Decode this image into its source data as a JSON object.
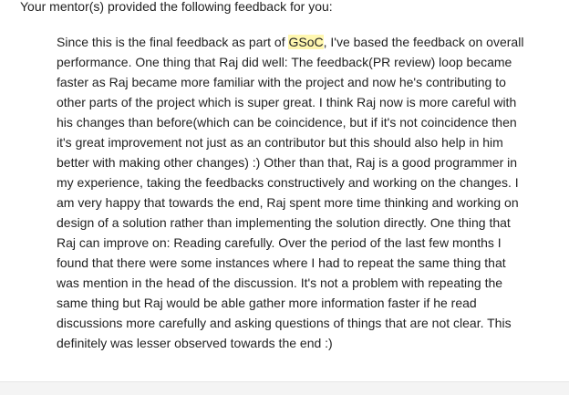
{
  "intro": "Your mentor(s) provided the following feedback for you:",
  "feedback": {
    "line1_before": "Since this is the final feedback as part of ",
    "highlight": "GSoC",
    "line1_after": ", I've based the feedback on overall",
    "lines": [
      "performance. One thing that Raj did well: The feedback(PR review) loop became",
      "faster as Raj became more familiar with the project and now he's contributing to",
      "other parts of the project which is super great. I think Raj now is more careful with",
      "his changes than before(which can be coincidence, but if it's not coincidence then",
      "it's great improvement not just as an contributor but this should also help in him",
      "better with making other changes) :) Other than that, Raj is a good programmer in",
      "my experience, taking the feedbacks constructively and working on the changes. I",
      "am very happy that towards the end, Raj spent more time thinking and working on",
      "design of a solution rather than implementing the solution directly. One thing that",
      "Raj can improve on: Reading carefully. Over the period of the last few months I",
      "found that there were some instances where I had to repeat the same thing that",
      "was mention in the head of the discussion. It's not a problem with repeating the",
      "same thing but Raj would be able gather more information faster if he read",
      "discussions more carefully and asking questions of things that are not clear. This",
      "definitely was lesser observed towards the end :)"
    ]
  },
  "colors": {
    "text": "#222222",
    "highlight": "#fff7b0",
    "footer": "#f4f4f4"
  }
}
